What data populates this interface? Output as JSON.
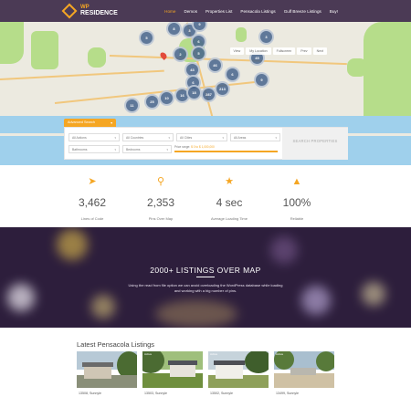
{
  "brand": {
    "line1": "WP",
    "line2": "RESIDENCE"
  },
  "nav": {
    "items": [
      "Home",
      "Demos",
      "Properties List",
      "Pensacola Listings",
      "Gulf Breeze Listings",
      "Buy!"
    ],
    "active": "Home"
  },
  "map": {
    "controls": [
      "View",
      "My Location",
      "Fullscreen",
      "Prev",
      "Next"
    ],
    "clusters": [
      "5",
      "8",
      "3",
      "9",
      "3",
      "6",
      "2",
      "5",
      "45",
      "46",
      "43",
      "9",
      "6",
      "11",
      "25",
      "10",
      "16",
      "18",
      "287",
      "213",
      "6"
    ]
  },
  "search": {
    "tab_label": "Advanced Search",
    "fields": [
      "All Actions",
      "All Countries",
      "All Cities",
      "All Areas",
      "Bathrooms",
      "Bedrooms"
    ],
    "price_label": "Price range:",
    "price_value": "$ 0 to $ 1,000,000",
    "button": "SEARCH PROPERTIES"
  },
  "stats": [
    {
      "icon": "paper-plane",
      "value": "3,462",
      "label": "Lines of Code"
    },
    {
      "icon": "map-pin",
      "value": "2,353",
      "label": "Pins Over Map"
    },
    {
      "icon": "star",
      "value": "4 sec",
      "label": "Average Loading Time"
    },
    {
      "icon": "thumbs-up",
      "value": "100%",
      "label": "Reliable"
    }
  ],
  "banner": {
    "title": "2000+ LISTINGS OVER MAP",
    "text": "Using the read from file option we can avoid overloading the WordPress database while loading and working with a big number of pins."
  },
  "listings": {
    "title": "Latest Pensacola Listings",
    "cards": [
      {
        "badge": "",
        "caption": "13508, Sunnyle"
      },
      {
        "badge": "Active",
        "caption": "13503, Sunnyle"
      },
      {
        "badge": "Active",
        "caption": "13502, Sunnyle"
      },
      {
        "badge": "Active",
        "caption": "13499, Sunnyle"
      }
    ]
  },
  "colors": {
    "accent": "#f5a623",
    "header": "#4b3a55",
    "marker": "#46648c",
    "banner": "#2d1e3c"
  }
}
